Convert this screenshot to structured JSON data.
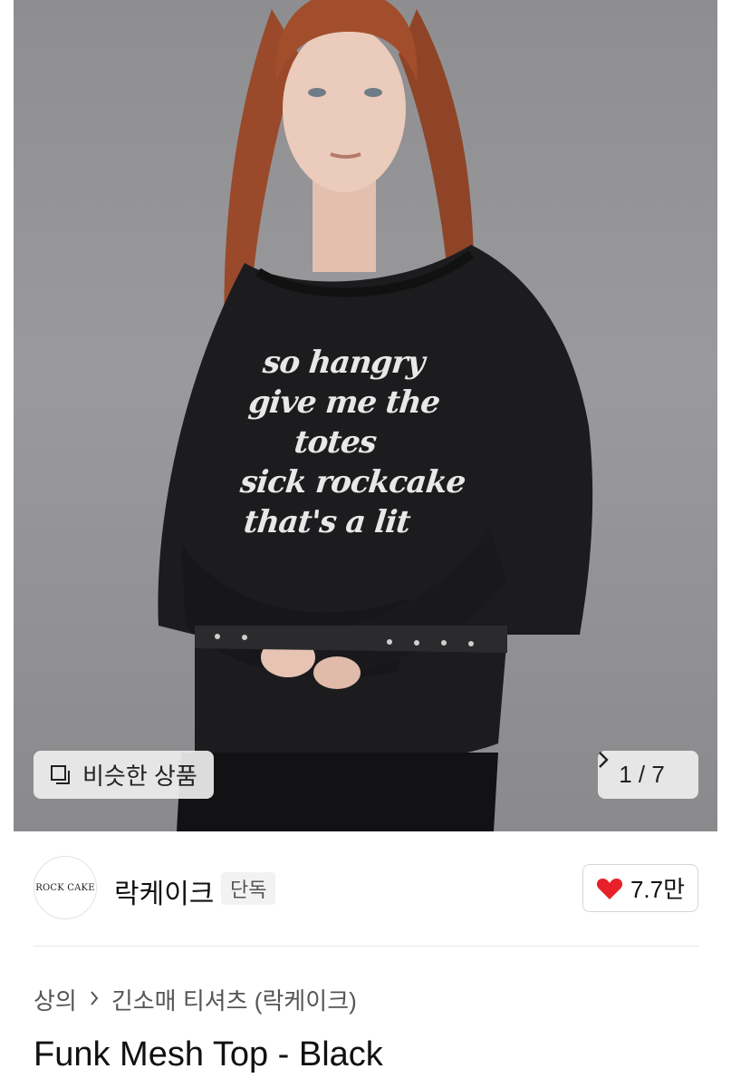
{
  "hero": {
    "shirt_print_lines": [
      "so hangry",
      "give me the",
      "totes",
      "sick rockcake",
      "that's a lit"
    ],
    "similar_button_label": "비슷한 상품",
    "counter_text": "1 / 7",
    "icons": {
      "similar": "copy-squares-icon",
      "next": "chevron-right-icon"
    }
  },
  "brand": {
    "logo_text": "ROCK CAKE",
    "name": "락케이크",
    "tag": "단독",
    "like_count": "7.7만",
    "like_icon": "heart-icon",
    "like_color": "#e8202a"
  },
  "breadcrumb": {
    "items": [
      "상의",
      "긴소매 티셔츠 (락케이크)"
    ],
    "separator": ">"
  },
  "product": {
    "title": "Funk Mesh Top - Black"
  }
}
